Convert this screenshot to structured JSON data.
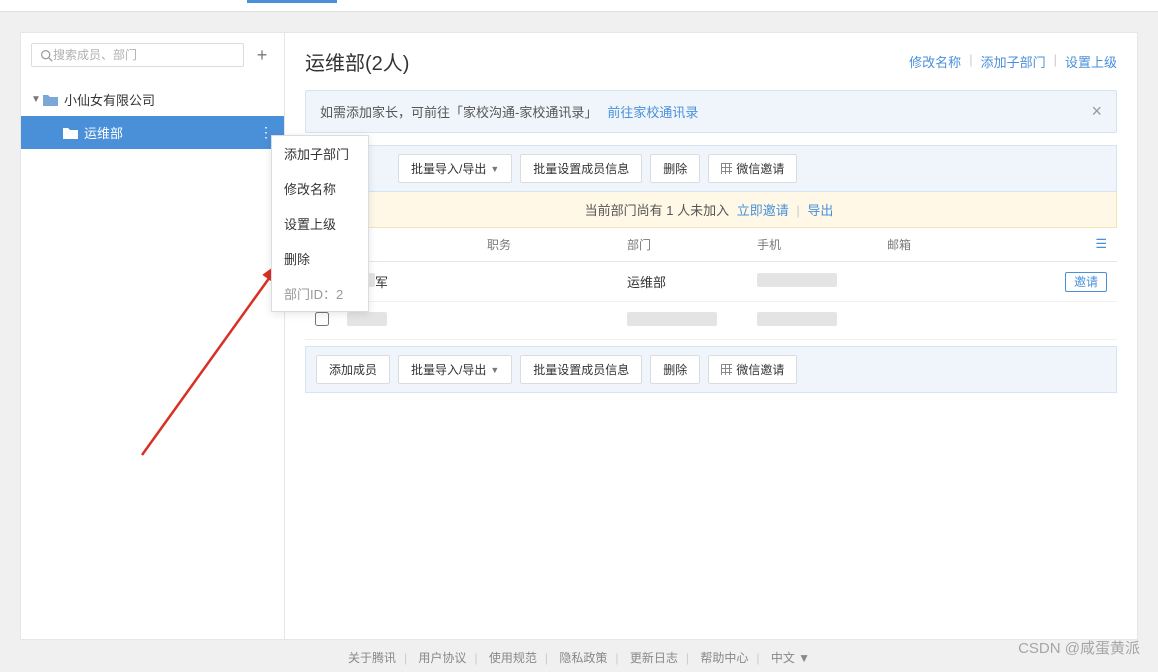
{
  "search": {
    "placeholder": "搜索成员、部门"
  },
  "tree": {
    "root": {
      "label": "小仙女有限公司"
    },
    "child": {
      "label": "运维部"
    }
  },
  "contextMenu": {
    "items": [
      "添加子部门",
      "修改名称",
      "设置上级",
      "删除"
    ],
    "id_label": "部门ID：2"
  },
  "main": {
    "title": "运维部(2人)",
    "actions": {
      "rename": "修改名称",
      "addSub": "添加子部门",
      "setParent": "设置上级"
    }
  },
  "banner": {
    "text": "如需添加家长，可前往「家校沟通-家校通讯录」",
    "link": "前往家校通讯录"
  },
  "toolbar": {
    "addMember": "添加成员",
    "batchIO": "批量导入/导出",
    "batchSet": "批量设置成员信息",
    "delete": "删除",
    "wechatInvite": "微信邀请"
  },
  "warning": {
    "prefix": "当前部门尚有 1 人未加入",
    "invite": "立即邀请",
    "export": "导出"
  },
  "table": {
    "headers": {
      "position": "职务",
      "department": "部门",
      "phone": "手机",
      "email": "邮箱"
    },
    "rows": [
      {
        "name_suffix": "军",
        "dept": "运维部",
        "invite": true
      },
      {
        "name_suffix": "",
        "dept": "",
        "invite": false
      }
    ],
    "inviteBtn": "邀请"
  },
  "footer": {
    "items": [
      "关于腾讯",
      "用户协议",
      "使用规范",
      "隐私政策",
      "更新日志",
      "帮助中心",
      "中文 ▼"
    ]
  },
  "watermark": "CSDN @咸蛋黄派"
}
